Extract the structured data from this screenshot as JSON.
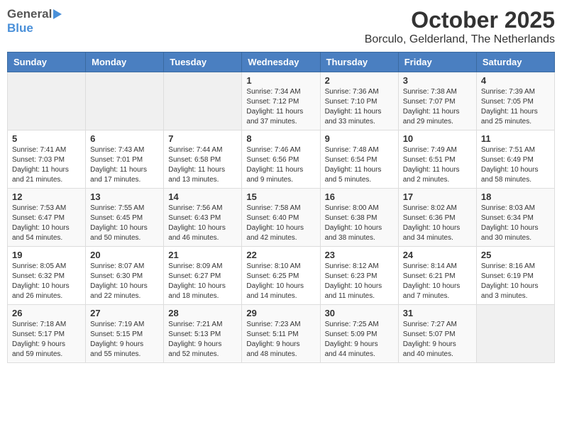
{
  "header": {
    "logo_general": "General",
    "logo_blue": "Blue",
    "month": "October 2025",
    "location": "Borculo, Gelderland, The Netherlands"
  },
  "days_of_week": [
    "Sunday",
    "Monday",
    "Tuesday",
    "Wednesday",
    "Thursday",
    "Friday",
    "Saturday"
  ],
  "weeks": [
    {
      "days": [
        {
          "num": "",
          "info": ""
        },
        {
          "num": "",
          "info": ""
        },
        {
          "num": "",
          "info": ""
        },
        {
          "num": "1",
          "info": "Sunrise: 7:34 AM\nSunset: 7:12 PM\nDaylight: 11 hours\nand 37 minutes."
        },
        {
          "num": "2",
          "info": "Sunrise: 7:36 AM\nSunset: 7:10 PM\nDaylight: 11 hours\nand 33 minutes."
        },
        {
          "num": "3",
          "info": "Sunrise: 7:38 AM\nSunset: 7:07 PM\nDaylight: 11 hours\nand 29 minutes."
        },
        {
          "num": "4",
          "info": "Sunrise: 7:39 AM\nSunset: 7:05 PM\nDaylight: 11 hours\nand 25 minutes."
        }
      ]
    },
    {
      "days": [
        {
          "num": "5",
          "info": "Sunrise: 7:41 AM\nSunset: 7:03 PM\nDaylight: 11 hours\nand 21 minutes."
        },
        {
          "num": "6",
          "info": "Sunrise: 7:43 AM\nSunset: 7:01 PM\nDaylight: 11 hours\nand 17 minutes."
        },
        {
          "num": "7",
          "info": "Sunrise: 7:44 AM\nSunset: 6:58 PM\nDaylight: 11 hours\nand 13 minutes."
        },
        {
          "num": "8",
          "info": "Sunrise: 7:46 AM\nSunset: 6:56 PM\nDaylight: 11 hours\nand 9 minutes."
        },
        {
          "num": "9",
          "info": "Sunrise: 7:48 AM\nSunset: 6:54 PM\nDaylight: 11 hours\nand 5 minutes."
        },
        {
          "num": "10",
          "info": "Sunrise: 7:49 AM\nSunset: 6:51 PM\nDaylight: 11 hours\nand 2 minutes."
        },
        {
          "num": "11",
          "info": "Sunrise: 7:51 AM\nSunset: 6:49 PM\nDaylight: 10 hours\nand 58 minutes."
        }
      ]
    },
    {
      "days": [
        {
          "num": "12",
          "info": "Sunrise: 7:53 AM\nSunset: 6:47 PM\nDaylight: 10 hours\nand 54 minutes."
        },
        {
          "num": "13",
          "info": "Sunrise: 7:55 AM\nSunset: 6:45 PM\nDaylight: 10 hours\nand 50 minutes."
        },
        {
          "num": "14",
          "info": "Sunrise: 7:56 AM\nSunset: 6:43 PM\nDaylight: 10 hours\nand 46 minutes."
        },
        {
          "num": "15",
          "info": "Sunrise: 7:58 AM\nSunset: 6:40 PM\nDaylight: 10 hours\nand 42 minutes."
        },
        {
          "num": "16",
          "info": "Sunrise: 8:00 AM\nSunset: 6:38 PM\nDaylight: 10 hours\nand 38 minutes."
        },
        {
          "num": "17",
          "info": "Sunrise: 8:02 AM\nSunset: 6:36 PM\nDaylight: 10 hours\nand 34 minutes."
        },
        {
          "num": "18",
          "info": "Sunrise: 8:03 AM\nSunset: 6:34 PM\nDaylight: 10 hours\nand 30 minutes."
        }
      ]
    },
    {
      "days": [
        {
          "num": "19",
          "info": "Sunrise: 8:05 AM\nSunset: 6:32 PM\nDaylight: 10 hours\nand 26 minutes."
        },
        {
          "num": "20",
          "info": "Sunrise: 8:07 AM\nSunset: 6:30 PM\nDaylight: 10 hours\nand 22 minutes."
        },
        {
          "num": "21",
          "info": "Sunrise: 8:09 AM\nSunset: 6:27 PM\nDaylight: 10 hours\nand 18 minutes."
        },
        {
          "num": "22",
          "info": "Sunrise: 8:10 AM\nSunset: 6:25 PM\nDaylight: 10 hours\nand 14 minutes."
        },
        {
          "num": "23",
          "info": "Sunrise: 8:12 AM\nSunset: 6:23 PM\nDaylight: 10 hours\nand 11 minutes."
        },
        {
          "num": "24",
          "info": "Sunrise: 8:14 AM\nSunset: 6:21 PM\nDaylight: 10 hours\nand 7 minutes."
        },
        {
          "num": "25",
          "info": "Sunrise: 8:16 AM\nSunset: 6:19 PM\nDaylight: 10 hours\nand 3 minutes."
        }
      ]
    },
    {
      "days": [
        {
          "num": "26",
          "info": "Sunrise: 7:18 AM\nSunset: 5:17 PM\nDaylight: 9 hours\nand 59 minutes."
        },
        {
          "num": "27",
          "info": "Sunrise: 7:19 AM\nSunset: 5:15 PM\nDaylight: 9 hours\nand 55 minutes."
        },
        {
          "num": "28",
          "info": "Sunrise: 7:21 AM\nSunset: 5:13 PM\nDaylight: 9 hours\nand 52 minutes."
        },
        {
          "num": "29",
          "info": "Sunrise: 7:23 AM\nSunset: 5:11 PM\nDaylight: 9 hours\nand 48 minutes."
        },
        {
          "num": "30",
          "info": "Sunrise: 7:25 AM\nSunset: 5:09 PM\nDaylight: 9 hours\nand 44 minutes."
        },
        {
          "num": "31",
          "info": "Sunrise: 7:27 AM\nSunset: 5:07 PM\nDaylight: 9 hours\nand 40 minutes."
        },
        {
          "num": "",
          "info": ""
        }
      ]
    }
  ]
}
